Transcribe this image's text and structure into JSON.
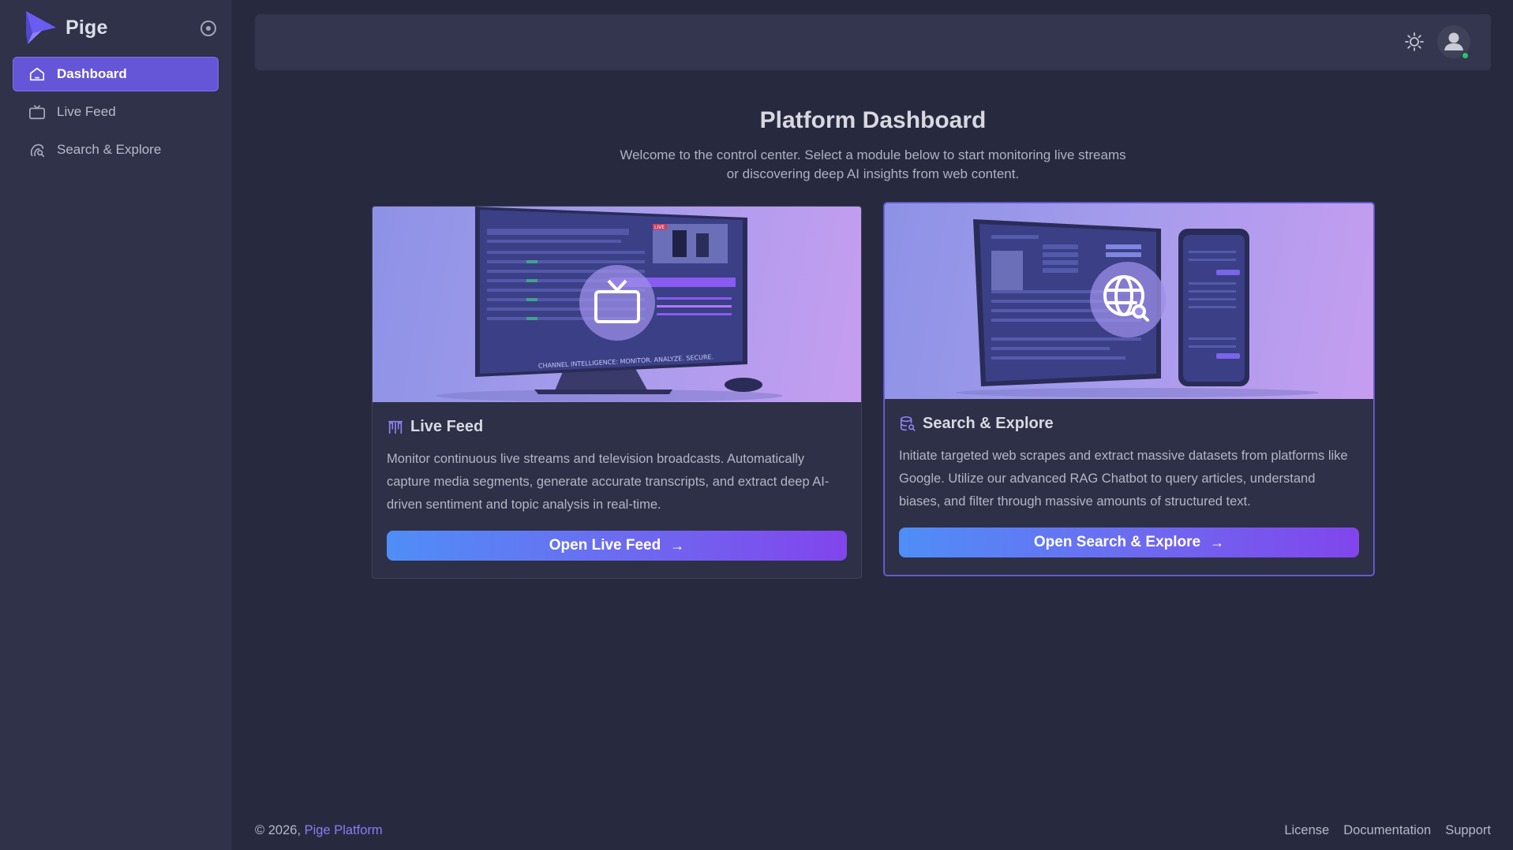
{
  "brand": {
    "name": "Pige"
  },
  "sidebar": {
    "items": [
      {
        "label": "Dashboard",
        "icon": "home-icon",
        "active": true
      },
      {
        "label": "Live Feed",
        "icon": "tv-icon",
        "active": false
      },
      {
        "label": "Search & Explore",
        "icon": "search-explore-icon",
        "active": false
      }
    ]
  },
  "topbar": {
    "theme_icon": "sun-icon",
    "avatar_icon": "user-avatar-icon",
    "status": "online"
  },
  "main": {
    "title": "Platform Dashboard",
    "subtitle_line1": "Welcome to the control center. Select a module below to start monitoring live streams",
    "subtitle_line2": "or discovering deep AI insights from web content.",
    "cards": [
      {
        "title": "Live Feed",
        "icon": "antenna-icon",
        "image_icon": "tv-icon",
        "monitor_caption": "CHANNEL INTELLIGENCE: MONITOR. ANALYZE. SECURE.",
        "monitor_badge": "LIVE",
        "description": "Monitor continuous live streams and television broadcasts. Automatically capture media segments, generate accurate transcripts, and extract deep AI-driven sentiment and topic analysis in real-time.",
        "button": "Open Live Feed"
      },
      {
        "title": "Search & Explore",
        "icon": "database-search-icon",
        "image_icon": "globe-search-icon",
        "description": "Initiate targeted web scrapes and extract massive datasets from platforms like Google. Utilize our advanced RAG Chatbot to query articles, understand biases, and filter through massive amounts of structured text.",
        "button": "Open Search & Explore"
      }
    ]
  },
  "footer": {
    "copyright": "© 2026,",
    "platform_link": "Pige Platform",
    "links": [
      "License",
      "Documentation",
      "Support"
    ]
  },
  "colors": {
    "accent": "#6556d8",
    "background": "#272a3e",
    "sidebar": "#2f3249",
    "link": "#8a7cf5"
  }
}
